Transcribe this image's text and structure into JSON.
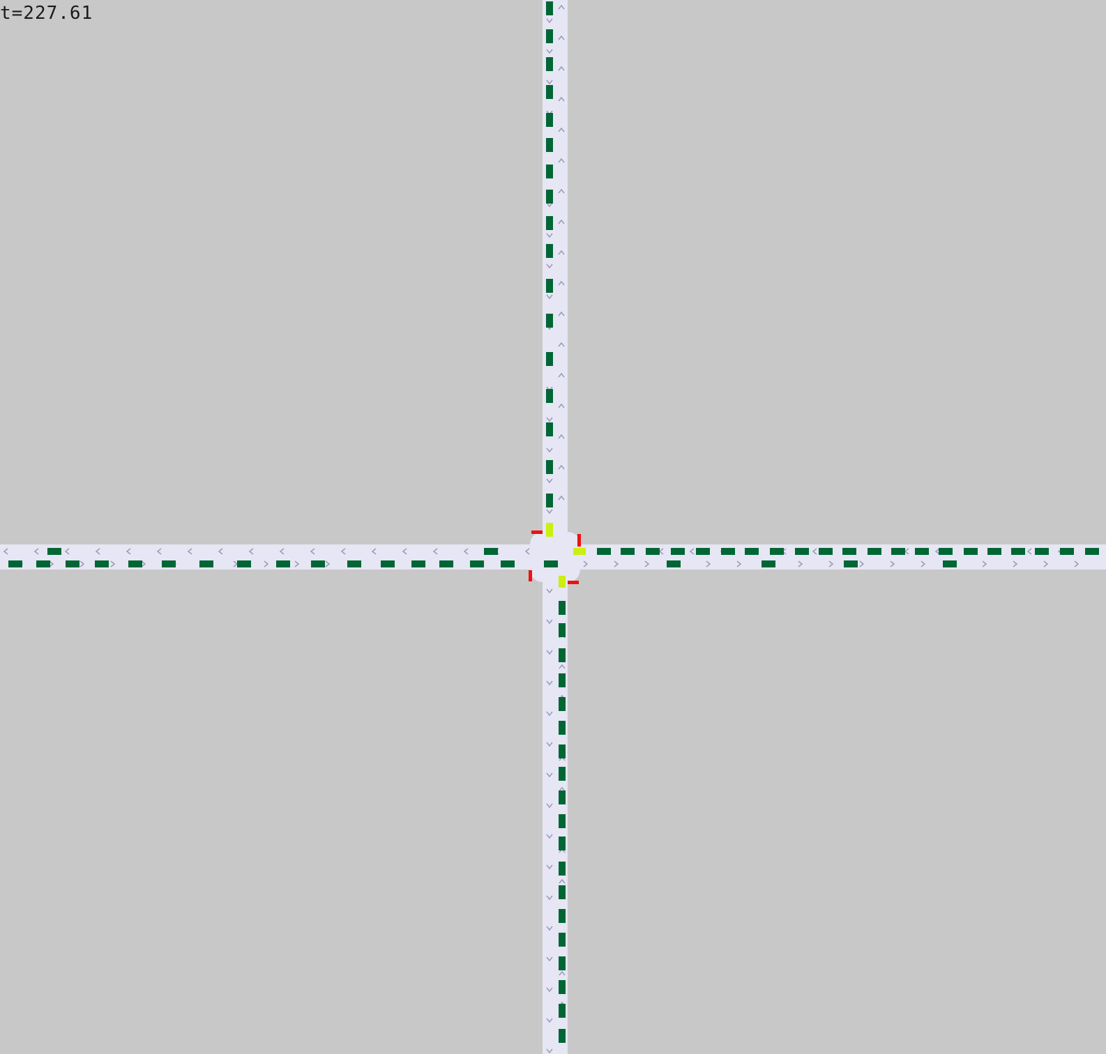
{
  "time_display": "t=227.61",
  "colors": {
    "background": "#c8c8c8",
    "road": "#e6e6f5",
    "lane_arrow": "#9a9ab8",
    "vehicle": "#006633",
    "vehicle_braking": "#ccee11",
    "signal_red": "#ee1111"
  },
  "icons": {
    "lane_arrow": "chevron-icon",
    "vehicle": "vehicle-marker-icon",
    "signal": "red-signal-icon"
  }
}
